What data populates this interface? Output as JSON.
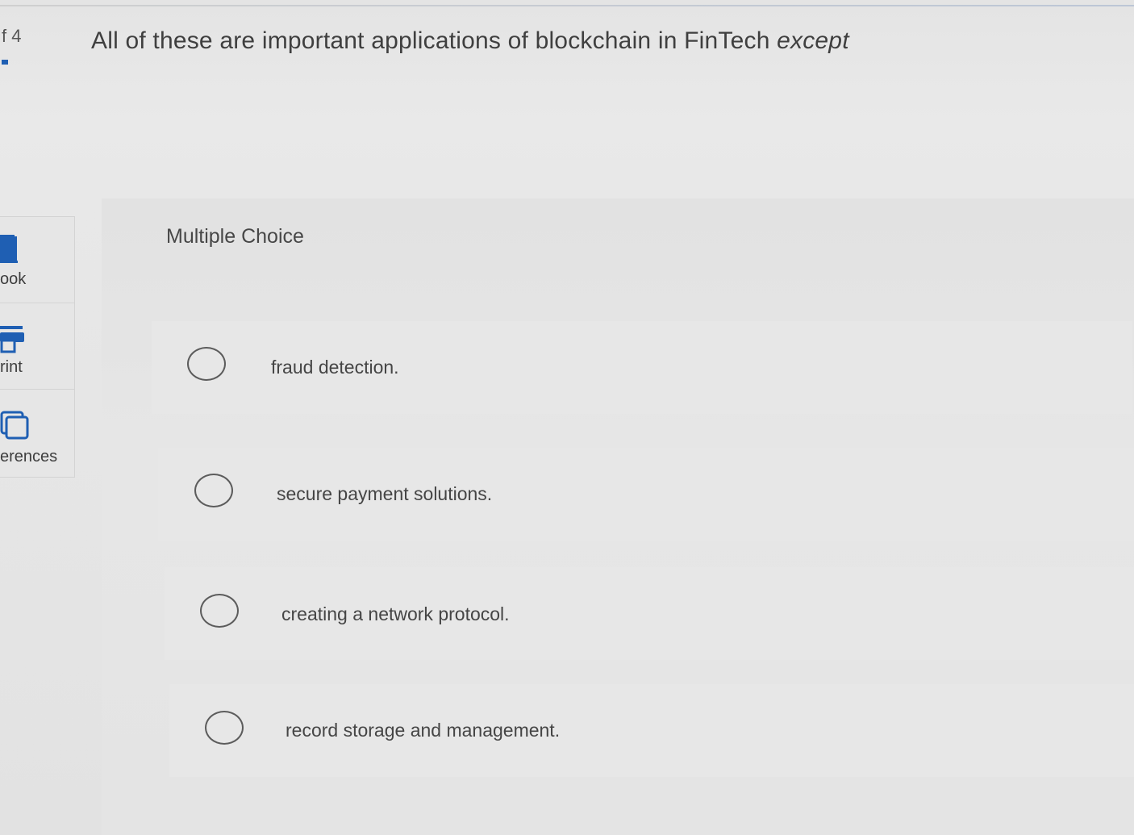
{
  "question": {
    "number": "f 4",
    "text": "All of these are important applications of blockchain in FinTech",
    "emphasis": "except"
  },
  "sidebar": {
    "items": [
      {
        "label": "ook",
        "icon": "book-icon"
      },
      {
        "label": "rint",
        "icon": "printer-icon"
      },
      {
        "label": "erences",
        "icon": "references-icon"
      }
    ]
  },
  "answer_area": {
    "type_label": "Multiple Choice",
    "choices": [
      {
        "label": "fraud detection."
      },
      {
        "label": "secure payment solutions."
      },
      {
        "label": "creating a network protocol."
      },
      {
        "label": "record storage and management."
      }
    ]
  },
  "colors": {
    "accent": "#1f5fb3",
    "text": "#3f3f3f",
    "background": "#e6e6e6"
  }
}
